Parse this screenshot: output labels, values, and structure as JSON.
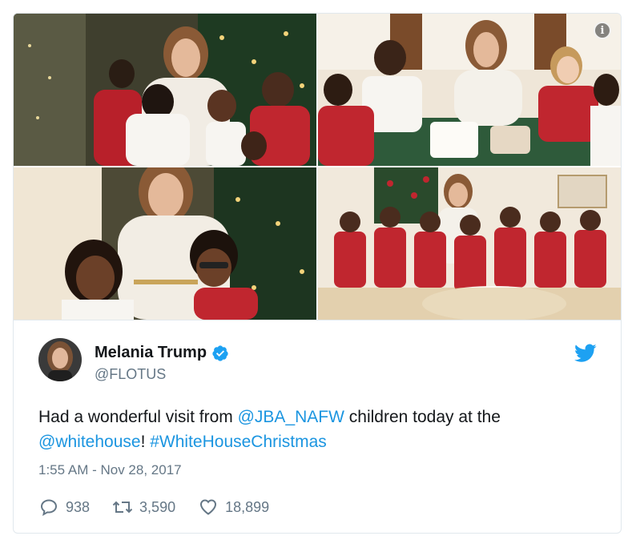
{
  "tweet": {
    "author_name": "Melania Trump",
    "author_handle": "@FLOTUS",
    "text_parts": [
      {
        "text": "Had a wonderful visit from ",
        "link": false
      },
      {
        "text": "@JBA_NAFW",
        "link": true
      },
      {
        "text": " children today at the ",
        "link": false
      },
      {
        "text": "@whitehouse",
        "link": true
      },
      {
        "text": "! ",
        "link": false
      },
      {
        "text": "#WhiteHouseChristmas",
        "link": true
      }
    ],
    "timestamp": "1:55 AM - Nov 28, 2017",
    "replies": "938",
    "retweets": "3,590",
    "likes": "18,899"
  },
  "media": {
    "info_label": "i",
    "photos": [
      {
        "name": "photo-hug-children",
        "description_icon": "photo-icon"
      },
      {
        "name": "photo-crafts-table",
        "description_icon": "photo-icon"
      },
      {
        "name": "photo-smiling-children",
        "description_icon": "photo-icon"
      },
      {
        "name": "photo-group-portrait",
        "description_icon": "photo-icon"
      }
    ]
  },
  "icons": {
    "verified": "verified-badge-icon",
    "brand": "twitter-bird-icon",
    "reply": "reply-icon",
    "retweet": "retweet-icon",
    "like": "heart-icon",
    "info": "info-icon"
  },
  "colors": {
    "link": "#1b95e0",
    "text": "#14171a",
    "secondary": "#657786",
    "twitter_blue": "#1da1f2",
    "border": "#e1e8ed"
  }
}
